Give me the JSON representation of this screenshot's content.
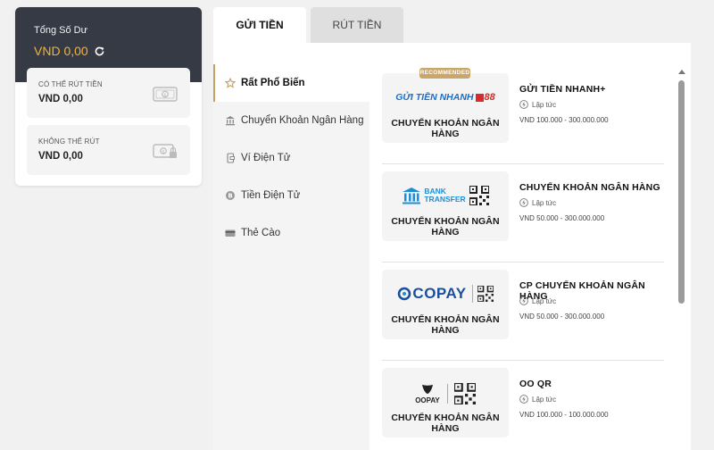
{
  "balance": {
    "title": "Tổng Số Dư",
    "amount": "VND 0,00",
    "withdrawable": {
      "label": "CÓ THỂ RÚT TIỀN",
      "amount": "VND 0,00"
    },
    "non_withdrawable": {
      "label": "KHÔNG THỂ RÚT",
      "amount": "VND 0,00"
    }
  },
  "tabs": [
    {
      "label": "GỬI TIỀN"
    },
    {
      "label": "RÚT TIỀN"
    }
  ],
  "categories": [
    {
      "label": "Rất Phổ Biến",
      "icon": "star-icon"
    },
    {
      "label": "Chuyển Khoản Ngân Hàng",
      "icon": "bank-icon"
    },
    {
      "label": "Ví Điện Tử",
      "icon": "wallet-icon"
    },
    {
      "label": "Tiền Điện Tử",
      "icon": "bitcoin-icon"
    },
    {
      "label": "Thẻ Cào",
      "icon": "card-icon"
    }
  ],
  "methods": [
    {
      "badge": "RECOMMENDED",
      "logo_text": "GỬI TIỀN NHANH",
      "logo_suffix": "88",
      "caption": "CHUYỂN KHOẢN NGÂN HÀNG",
      "name": "GỬI TIỀN NHANH+",
      "speed": "Lập tức",
      "range": "VND 100.000 - 300.000.000"
    },
    {
      "logo_line1": "BANK",
      "logo_line2": "TRANSFER",
      "caption": "CHUYỂN KHOẢN NGÂN HÀNG",
      "name": "CHUYỂN KHOẢN NGÂN HÀNG",
      "speed": "Lập tức",
      "range": "VND 50.000 - 300.000.000"
    },
    {
      "logo_text": "COPAY",
      "caption": "CHUYỂN KHOẢN NGÂN HÀNG",
      "name": "CP CHUYỂN KHOẢN NGÂN HÀNG",
      "speed": "Lập tức",
      "range": "VND 50.000 - 300.000.000"
    },
    {
      "logo_text": "OOPAY",
      "caption": "CHUYỂN KHOẢN NGÂN HÀNG",
      "name": "OO QR",
      "speed": "Lập tức",
      "range": "VND 100.000 - 100.000.000"
    }
  ],
  "colors": {
    "accent_gold": "#f2b530",
    "badge_gold": "#c9a66b",
    "header_dark": "#363a45",
    "bank_blue": "#1e8fd6",
    "copay_blue": "#1a4fa0"
  }
}
